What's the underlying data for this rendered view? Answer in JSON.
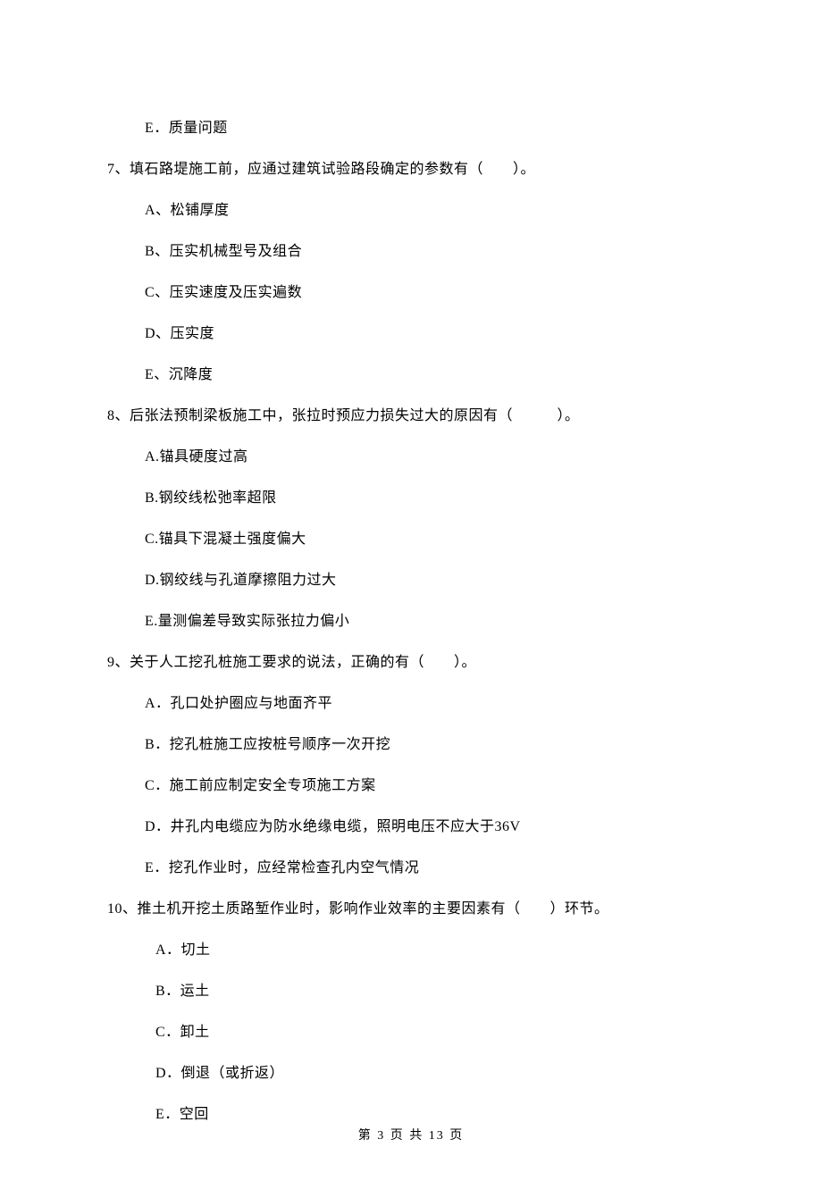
{
  "q6": {
    "options": {
      "E": "E．质量问题"
    }
  },
  "q7": {
    "stem": "7、填石路堤施工前，应通过建筑试验路段确定的参数有（　　）。",
    "options": {
      "A": "A、松铺厚度",
      "B": "B、压实机械型号及组合",
      "C": "C、压实速度及压实遍数",
      "D": "D、压实度",
      "E": "E、沉降度"
    }
  },
  "q8": {
    "stem": "8、后张法预制梁板施工中，张拉时预应力损失过大的原因有（　　　）。",
    "options": {
      "A": "A.锚具硬度过高",
      "B": "B.钢绞线松弛率超限",
      "C": "C.锚具下混凝土强度偏大",
      "D": "D.钢绞线与孔道摩擦阻力过大",
      "E": "E.量测偏差导致实际张拉力偏小"
    }
  },
  "q9": {
    "stem": "9、关于人工挖孔桩施工要求的说法，正确的有（　　）。",
    "options": {
      "A": "A．孔口处护圈应与地面齐平",
      "B": "B．挖孔桩施工应按桩号顺序一次开挖",
      "C": "C．施工前应制定安全专项施工方案",
      "D": "D．井孔内电缆应为防水绝缘电缆，照明电压不应大于36V",
      "E": "E．挖孔作业时，应经常检查孔内空气情况"
    }
  },
  "q10": {
    "stem": "10、推土机开挖土质路堑作业时，影响作业效率的主要因素有（　　）环节。",
    "options": {
      "A": "A．切土",
      "B": "B．运土",
      "C": "C．卸土",
      "D": "D．倒退（或折返）",
      "E": "E．空回"
    }
  },
  "footer": "第 3 页 共 13 页"
}
